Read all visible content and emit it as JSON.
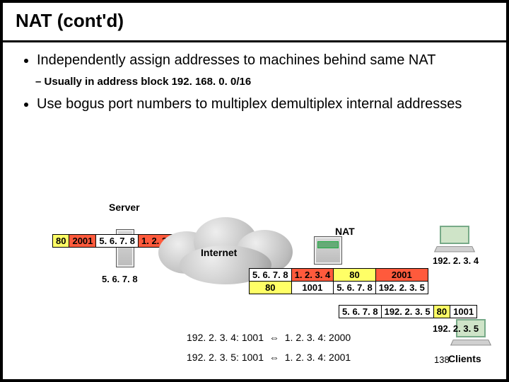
{
  "title": "NAT (cont'd)",
  "bullets": {
    "b1": "Independently assign addresses to machines behind same NAT",
    "b1_sub": "Usually in address block 192. 168. 0. 0/16",
    "b2": "Use bogus port numbers to multiplex demultiplex  internal addresses"
  },
  "labels": {
    "server": "Server",
    "server_ip": "5. 6. 7. 8",
    "internet": "Internet",
    "nat": "NAT",
    "client1_ip": "192. 2. 3. 4",
    "client2_ip": "192. 2. 3. 5",
    "clients": "Clients"
  },
  "packets": {
    "left": {
      "c1": "80",
      "c2": "2001",
      "c3": "5. 6. 7. 8",
      "c4": "1. 2. 3. 4"
    },
    "nat_top": {
      "c1": "5. 6. 7. 8",
      "c2": "1. 2. 3. 4",
      "c3": "80",
      "c4": "2001"
    },
    "nat_bottom": {
      "c1": "80",
      "c2": "1001",
      "c3": "5. 6. 7. 8",
      "c4": "192. 2. 3. 5"
    },
    "right": {
      "c1": "5. 6. 7. 8",
      "c2": "192. 2. 3. 5",
      "c3": "80",
      "c4": "1001"
    }
  },
  "mappings": {
    "m1_left": "192. 2. 3. 4: 1001",
    "m1_right": "1. 2. 3. 4: 2000",
    "m2_left": "192. 2. 3. 5: 1001",
    "m2_right": "1. 2. 3. 4: 2001"
  },
  "page_number": "138"
}
